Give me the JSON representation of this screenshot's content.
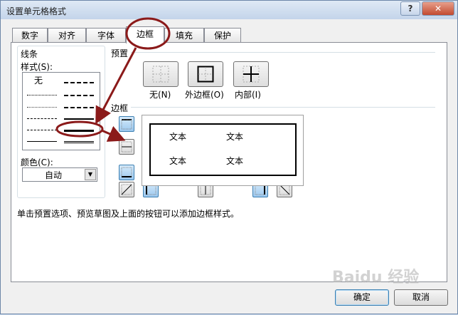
{
  "window": {
    "title": "设置单元格格式",
    "help_label": "?",
    "close_label": "✕"
  },
  "tabs": [
    "数字",
    "对齐",
    "字体",
    "边框",
    "填充",
    "保护"
  ],
  "active_tab": "边框",
  "line": {
    "group_label": "线条",
    "style_label": "样式(S):",
    "none_label": "无",
    "color_label": "颜色(C):",
    "color_value": "自动"
  },
  "presets": {
    "group_label": "预置",
    "none_label": "无(N)",
    "outline_label": "外边框(O)",
    "inside_label": "内部(I)"
  },
  "border": {
    "group_label": "边框",
    "preview_text": [
      "文本",
      "文本",
      "文本",
      "文本"
    ]
  },
  "hint": "单击预置选项、预览草图及上面的按钮可以添加边框样式。",
  "buttons": {
    "ok": "确定",
    "cancel": "取消"
  },
  "watermark": "Baidu 经验",
  "colors": {
    "annotation": "#8b1a1a",
    "accent": "#3c7fb1"
  }
}
